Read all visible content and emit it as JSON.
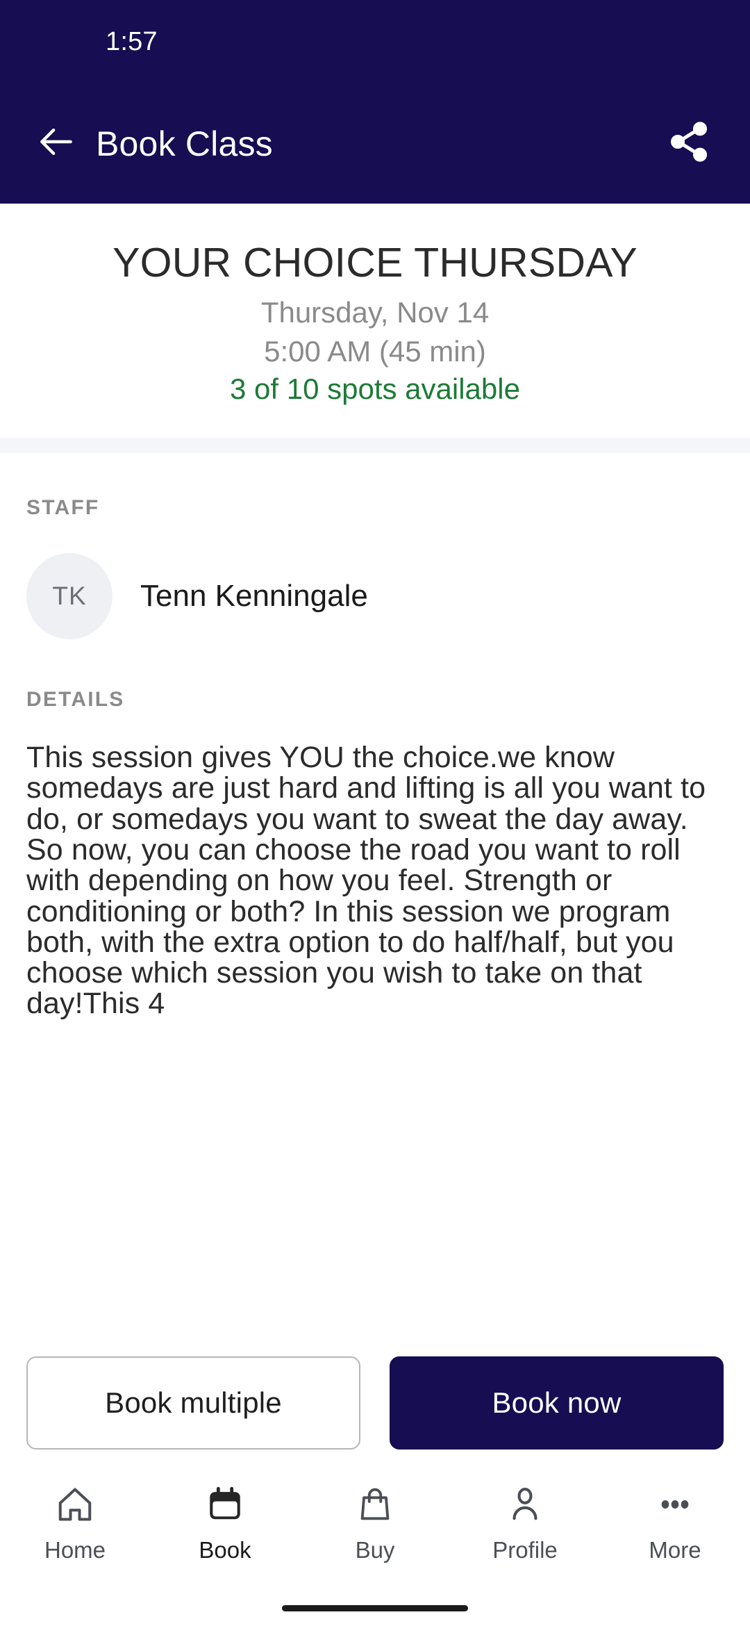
{
  "statusbar": {
    "time": "1:57"
  },
  "appbar": {
    "title": "Book Class",
    "back_icon": "arrow-left-icon",
    "share_icon": "share-icon",
    "background_color": "#160D52"
  },
  "hero": {
    "class_name": "YOUR CHOICE THURSDAY",
    "date": "Thursday, Nov 14",
    "time": "5:00 AM (45 min)",
    "spots": "3 of 10 spots available",
    "spots_color": "#1c7a36"
  },
  "staff": {
    "section_label": "STAFF",
    "avatar_initials": "TK",
    "name": "Tenn Kenningale"
  },
  "details": {
    "section_label": "DETAILS",
    "text": "This session gives YOU the choice.we know somedays are just hard and lifting is all you want to do, or somedays you want to sweat the day away. So now, you can choose the road you want to roll with depending on how you feel. Strength or conditioning or both? In this session we program both, with the extra option to do half/half, but you choose which session you wish to take on that day!This 4"
  },
  "actions": {
    "secondary_label": "Book multiple",
    "primary_label": "Book now",
    "primary_color": "#160D52"
  },
  "tabbar": {
    "items": [
      {
        "label": "Home",
        "icon": "home-icon",
        "active": false
      },
      {
        "label": "Book",
        "icon": "calendar-icon",
        "active": true
      },
      {
        "label": "Buy",
        "icon": "shopping-bag-icon",
        "active": false
      },
      {
        "label": "Profile",
        "icon": "person-icon",
        "active": false
      },
      {
        "label": "More",
        "icon": "ellipsis-icon",
        "active": false
      }
    ]
  }
}
